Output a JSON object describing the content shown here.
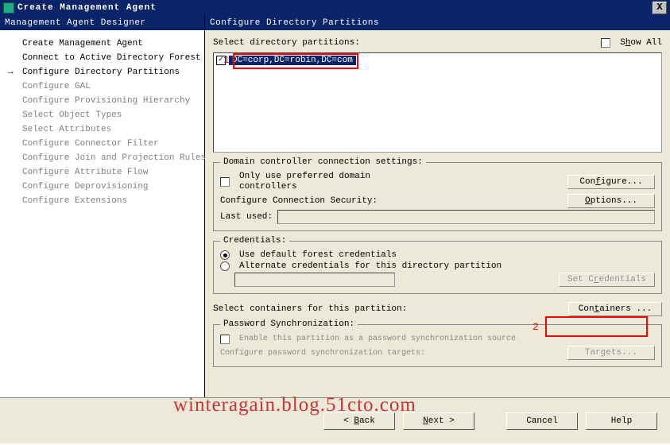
{
  "window": {
    "title": "Create Management Agent",
    "close": "X"
  },
  "left": {
    "header": "Management Agent Designer",
    "items": [
      {
        "label": "Create Management Agent",
        "enabled": true
      },
      {
        "label": "Connect to Active Directory Forest",
        "enabled": true
      },
      {
        "label": "Configure Directory Partitions",
        "enabled": true,
        "current": true
      },
      {
        "label": "Configure GAL"
      },
      {
        "label": "Configure Provisioning Hierarchy"
      },
      {
        "label": "Select Object Types"
      },
      {
        "label": "Select Attributes"
      },
      {
        "label": "Configure Connector Filter"
      },
      {
        "label": "Configure Join and Projection Rules"
      },
      {
        "label": "Configure Attribute Flow"
      },
      {
        "label": "Configure Deprovisioning"
      },
      {
        "label": "Configure Extensions"
      }
    ]
  },
  "right": {
    "header": "Configure Directory Partitions",
    "select_label": "Select directory partitions:",
    "show_all": "Show All",
    "partition_item": "DC=corp,DC=robin,DC=com",
    "dc_group": "Domain controller connection settings:",
    "only_preferred": "Only use preferred domain controllers",
    "configure_btn": "Configure...",
    "conn_sec": "Configure Connection Security:",
    "options_btn": "Options...",
    "last_used": "Last used:",
    "cred_group": "Credentials:",
    "cred_default": "Use default forest credentials",
    "cred_alt": "Alternate credentials for this directory partition",
    "set_cred_btn": "Set Credentials",
    "sel_containers": "Select containers for this partition:",
    "containers_btn": "Containers ...",
    "pw_group": "Password Synchronization:",
    "pw_enable": "Enable this partition as a password synchronization source",
    "pw_conf": "Configure password synchronization targets:",
    "targets_btn": "Targets..."
  },
  "buttons": {
    "back": "Back",
    "next": "Next",
    "cancel": "Cancel",
    "help": "Help"
  },
  "annotations": {
    "n1": "1",
    "n2": "2"
  },
  "watermark": "winteragain.blog.51cto.com"
}
